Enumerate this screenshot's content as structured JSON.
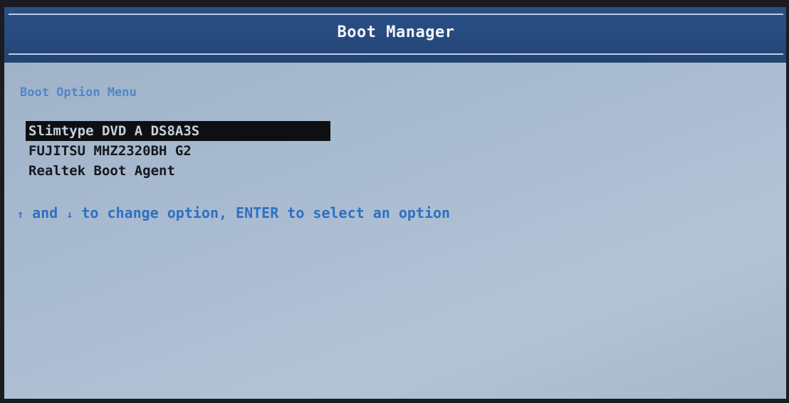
{
  "header": {
    "title": "Boot Manager"
  },
  "menu": {
    "section_title": "Boot Option Menu",
    "items": [
      {
        "label": "Slimtype DVD A  DS8A3S",
        "selected": true
      },
      {
        "label": "FUJITSU MHZ2320BH G2",
        "selected": false
      },
      {
        "label": "Realtek Boot Agent",
        "selected": false
      }
    ]
  },
  "help": {
    "up_arrow": "↑",
    "text_and": " and ",
    "down_arrow": "↓",
    "text_rest": " to change option, ENTER to select an option"
  },
  "colors": {
    "header_bg": "#2a4f86",
    "screen_bg": "#aabcd1",
    "section_title": "#4f86c8",
    "help_text": "#2f6fc2",
    "selected_bg": "#0e0f12"
  }
}
